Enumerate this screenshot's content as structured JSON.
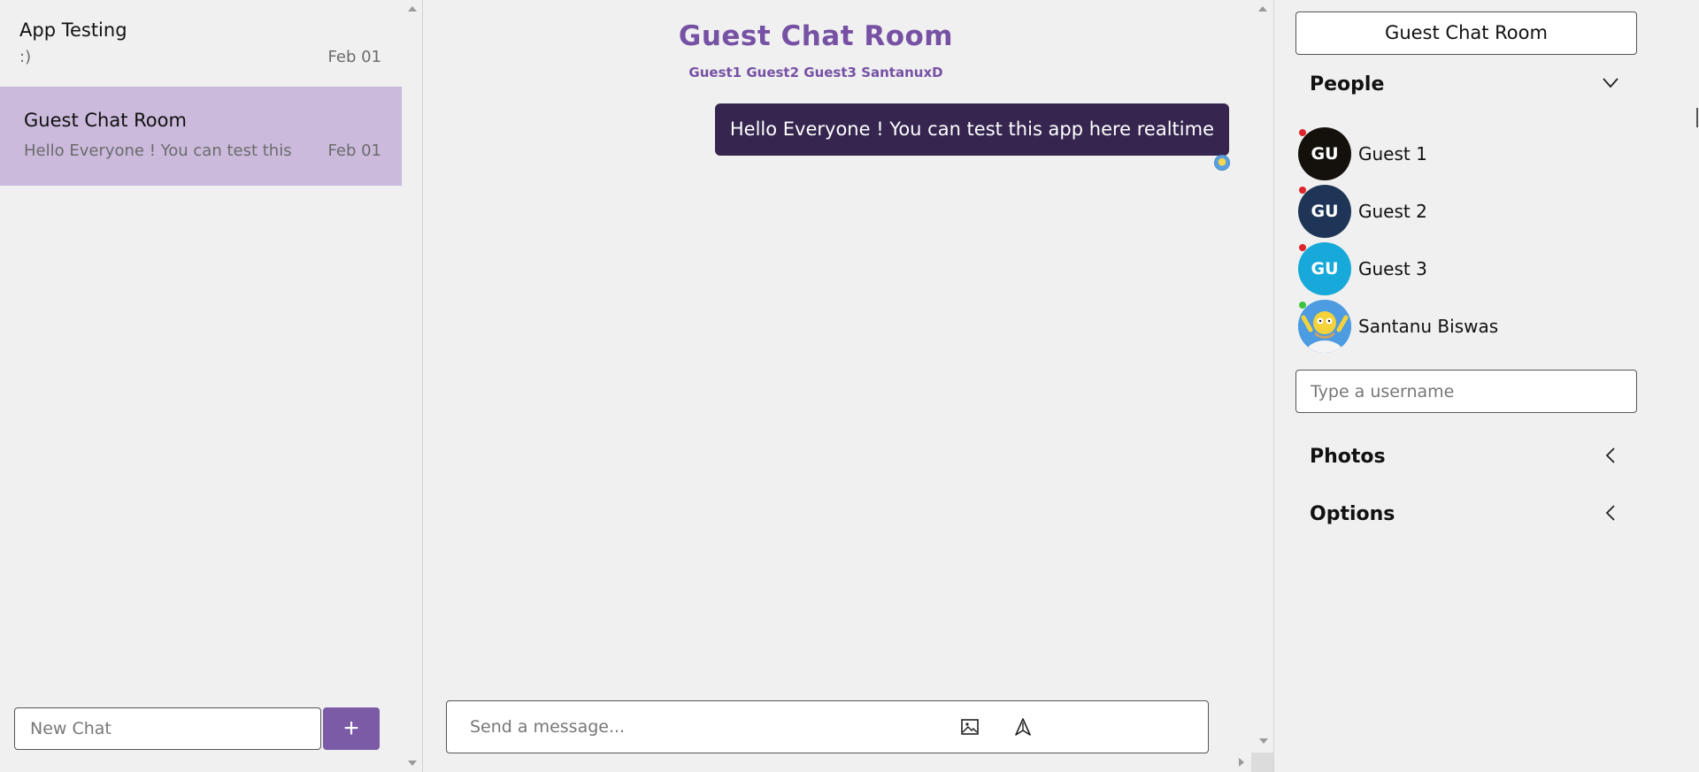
{
  "chat_list": {
    "items": [
      {
        "title": "App Testing",
        "preview": ":)",
        "date": "Feb 01"
      },
      {
        "title": "Guest Chat Room",
        "preview": "Hello Everyone ! You can test this app here realtime",
        "date": "Feb 01"
      }
    ],
    "new_chat_placeholder": "New Chat",
    "add_label": "+"
  },
  "chat": {
    "title": "Guest Chat Room",
    "members": "Guest1 Guest2 Guest3 SantanuxD",
    "messages": [
      {
        "text": "Hello Everyone ! You can test this app here realtime"
      }
    ],
    "input_placeholder": "Send a message..."
  },
  "settings": {
    "chat_name": "Guest Chat Room",
    "people_label": "People",
    "people": [
      {
        "initials": "GU",
        "name": "Guest 1",
        "avatar_color": "#14110d",
        "status_color": "#e0242b"
      },
      {
        "initials": "GU",
        "name": "Guest 2",
        "avatar_color": "#1e3557",
        "status_color": "#e0242b"
      },
      {
        "initials": "GU",
        "name": "Guest 3",
        "avatar_color": "#17a9d9",
        "status_color": "#e0242b"
      },
      {
        "initials": "",
        "name": "Santanu Biswas",
        "avatar_color": "#4d9be0",
        "status_color": "#3cc43c"
      }
    ],
    "username_placeholder": "Type a username",
    "photos_label": "Photos",
    "options_label": "Options"
  },
  "colors": {
    "accent": "#7b5ba6",
    "selected_chat": "#cbbadc",
    "message_bubble": "#35254f"
  }
}
